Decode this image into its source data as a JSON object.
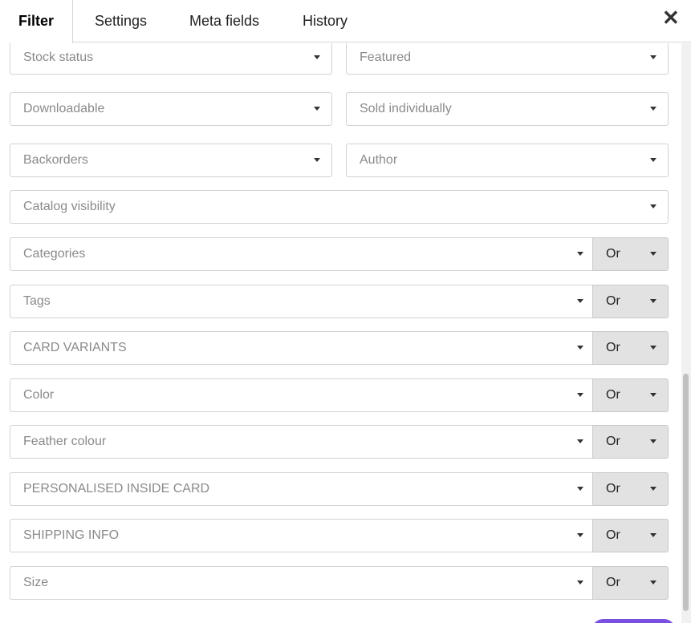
{
  "tabs": [
    {
      "label": "Filter",
      "active": true
    },
    {
      "label": "Settings",
      "active": false
    },
    {
      "label": "Meta fields",
      "active": false
    },
    {
      "label": "History",
      "active": false
    }
  ],
  "close_symbol": "✕",
  "pair_selects": [
    {
      "placeholder": "Stock status"
    },
    {
      "placeholder": "Featured"
    },
    {
      "placeholder": "Downloadable"
    },
    {
      "placeholder": "Sold individually"
    },
    {
      "placeholder": "Backorders"
    },
    {
      "placeholder": "Author"
    }
  ],
  "catalog_visibility": {
    "placeholder": "Catalog visibility"
  },
  "taxonomy_rows": [
    {
      "placeholder": "Categories",
      "operator": "Or"
    },
    {
      "placeholder": "Tags",
      "operator": "Or"
    },
    {
      "placeholder": "CARD VARIANTS",
      "operator": "Or"
    },
    {
      "placeholder": "Color",
      "operator": "Or"
    },
    {
      "placeholder": "Feather colour",
      "operator": "Or"
    },
    {
      "placeholder": "PERSONALISED INSIDE CARD",
      "operator": "Or"
    },
    {
      "placeholder": "SHIPPING INFO",
      "operator": "Or"
    },
    {
      "placeholder": "Size",
      "operator": "Or"
    }
  ],
  "colors": {
    "accent": "#7b4fe0",
    "operator_bg": "#e2e2e2",
    "placeholder": "#8a8a8a"
  }
}
